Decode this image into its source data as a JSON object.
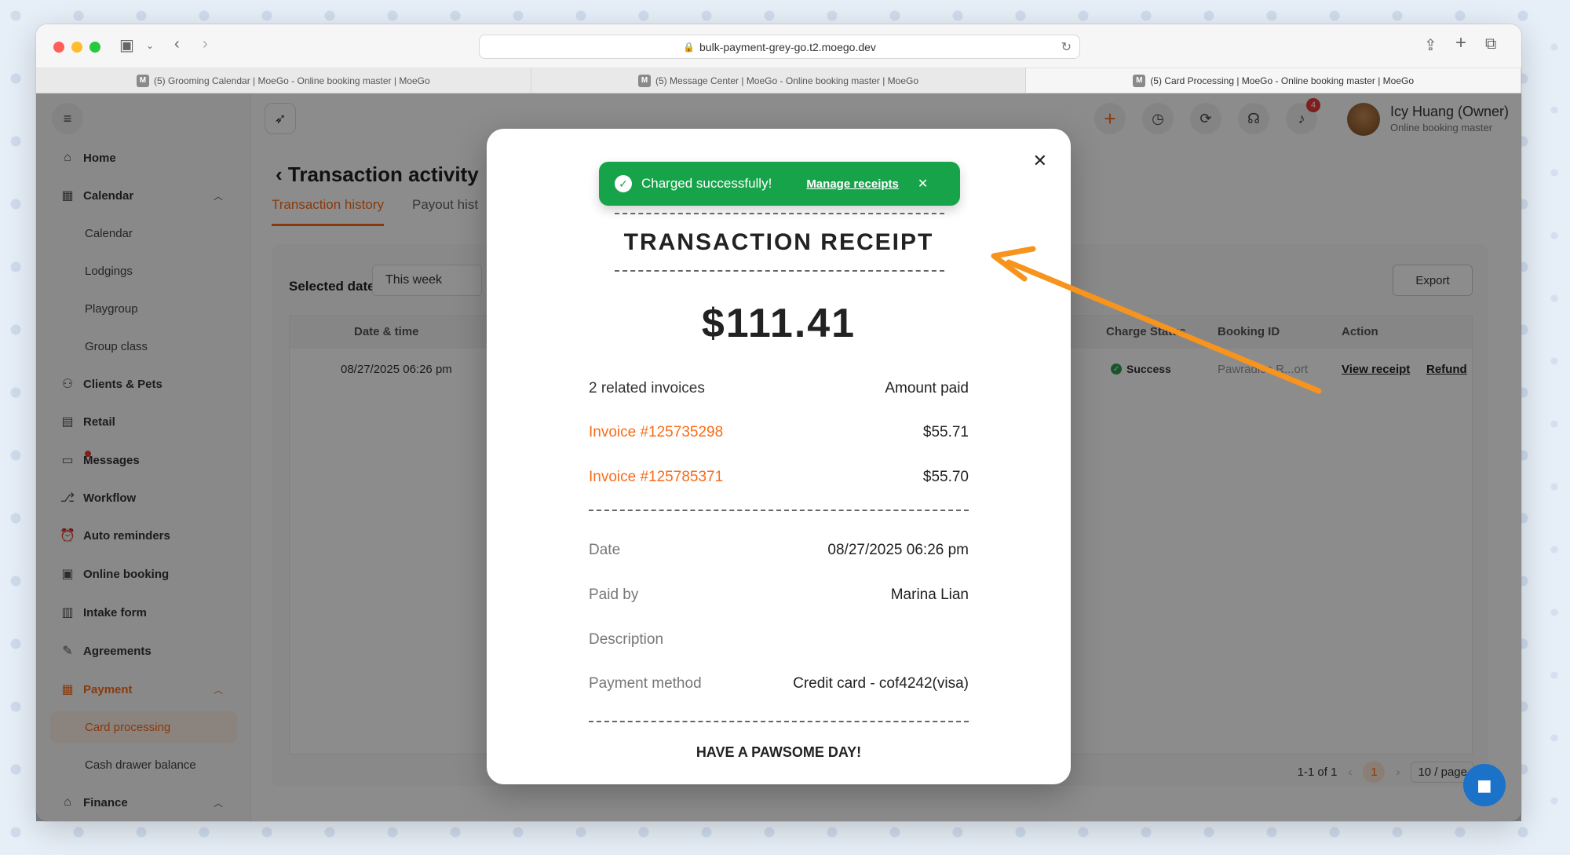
{
  "browser": {
    "url": "bulk-payment-grey-go.t2.moego.dev",
    "tabs": [
      {
        "favicon": "M",
        "title": "(5) Grooming Calendar | MoeGo - Online booking master | MoeGo"
      },
      {
        "favicon": "M",
        "title": "(5) Message Center | MoeGo - Online booking master | MoeGo"
      },
      {
        "favicon": "M",
        "title": "(5) Card Processing | MoeGo - Online booking master | MoeGo"
      }
    ]
  },
  "sidebar": {
    "items": [
      {
        "label": "Home",
        "icon": "home-icon"
      },
      {
        "label": "Calendar",
        "icon": "calendar-icon"
      },
      {
        "label": "Calendar"
      },
      {
        "label": "Lodgings"
      },
      {
        "label": "Playgroup"
      },
      {
        "label": "Group class"
      },
      {
        "label": "Clients & Pets",
        "icon": "clients-icon"
      },
      {
        "label": "Retail",
        "icon": "retail-icon"
      },
      {
        "label": "Messages",
        "icon": "messages-icon"
      },
      {
        "label": "Workflow",
        "icon": "workflow-icon"
      },
      {
        "label": "Auto reminders",
        "icon": "alarm-icon"
      },
      {
        "label": "Online booking",
        "icon": "online-booking-icon"
      },
      {
        "label": "Intake form",
        "icon": "form-icon"
      },
      {
        "label": "Agreements",
        "icon": "pen-icon"
      },
      {
        "label": "Payment",
        "icon": "payment-icon"
      },
      {
        "label": "Card processing"
      },
      {
        "label": "Cash drawer balance"
      },
      {
        "label": "Finance",
        "icon": "finance-icon"
      }
    ]
  },
  "header": {
    "user_name": "Icy Huang (Owner)",
    "user_subtitle": "Online booking master",
    "notification_count": "4"
  },
  "page": {
    "title": "Transaction activity",
    "tabs": [
      "Transaction history",
      "Payout hist"
    ],
    "selected_date_label": "Selected date:",
    "selected_date_value": "This week",
    "export_label": "Export",
    "columns": {
      "date_time": "Date & time",
      "charge_status": "Charge Status",
      "booking_id": "Booking ID",
      "action": "Action"
    },
    "row": {
      "date_time": "08/27/2025 06:26 pm",
      "charge_status": "Success",
      "booking_id": "Pawradise R...ort",
      "view_receipt": "View receipt",
      "refund": "Refund"
    },
    "pagination": {
      "summary": "1-1 of 1",
      "current": "1",
      "per_page": "10 / page"
    }
  },
  "modal": {
    "toast_text": "Charged successfully!",
    "toast_link": "Manage receipts",
    "title": "TRANSACTION RECEIPT",
    "amount": "$111.41",
    "invoices_label": "2 related invoices",
    "amount_paid_label": "Amount paid",
    "invoices": [
      {
        "label": "Invoice #125735298",
        "amount": "$55.71"
      },
      {
        "label": "Invoice #125785371",
        "amount": "$55.70"
      }
    ],
    "details": {
      "date_label": "Date",
      "date_value": "08/27/2025 06:26 pm",
      "paid_by_label": "Paid by",
      "paid_by_value": "Marina Lian",
      "description_label": "Description",
      "description_value": "",
      "payment_method_label": "Payment method",
      "payment_method_value": "Credit card - cof4242(visa)"
    },
    "footer": "HAVE A PAWSOME DAY!"
  },
  "colors": {
    "accent": "#f96b18",
    "success": "#17a34a",
    "annotation_arrow": "#f7941d"
  }
}
